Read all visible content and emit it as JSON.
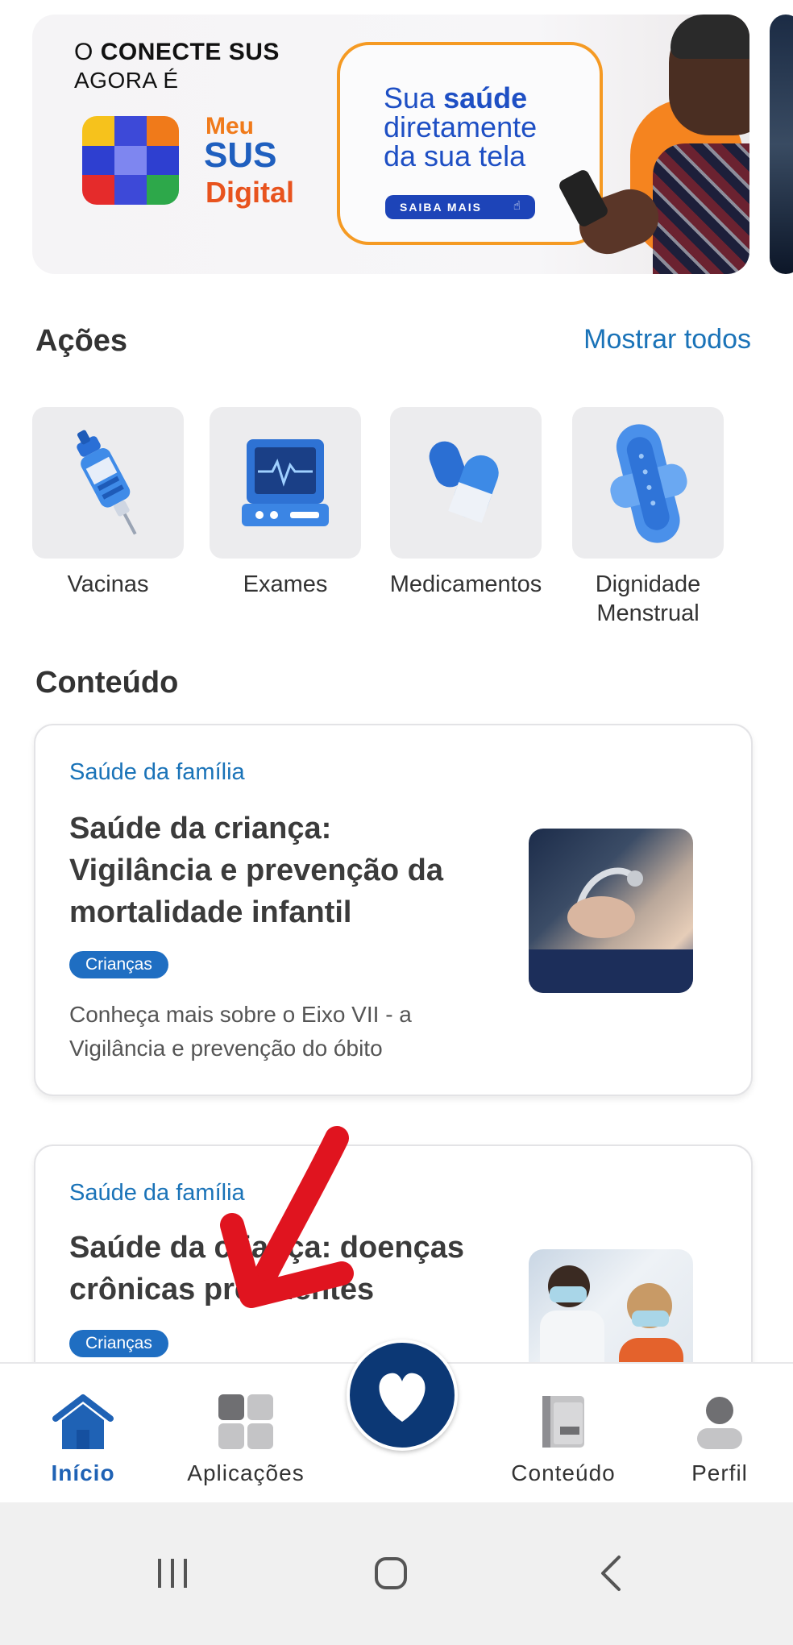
{
  "banner": {
    "line1_pre": "O",
    "line1_bold": "CONECTE SUS",
    "line2": "AGORA É",
    "brand_meu": "Meu",
    "brand_sus": "SUS",
    "brand_digital": "Digital",
    "tagline_1_pre": "Sua",
    "tagline_1_bold": "saúde",
    "tagline_2": "diretamente",
    "tagline_3": "da sua tela",
    "cta": "SAIBA MAIS"
  },
  "actions": {
    "title": "Ações",
    "show_all": "Mostrar todos",
    "items": [
      {
        "label": "Vacinas",
        "icon": "syringe-icon"
      },
      {
        "label": "Exames",
        "icon": "monitor-icon"
      },
      {
        "label": "Medicamentos",
        "icon": "pill-icon"
      },
      {
        "label_1": "Dignidade",
        "label_2": "Menstrual",
        "icon": "pad-icon"
      }
    ]
  },
  "content": {
    "title": "Conteúdo",
    "cards": [
      {
        "category": "Saúde da família",
        "title_1": "Saúde da criança:",
        "title_2": "Vigilância e prevenção da",
        "title_3": "mortalidade infantil",
        "tag": "Crianças",
        "desc_1": "Conheça mais sobre o Eixo VII - a",
        "desc_2": "Vigilância e prevenção do óbito"
      },
      {
        "category": "Saúde da família",
        "title_1": "Saúde da criança: doenças",
        "title_2": "crônicas prevalentes",
        "tag": "Crianças"
      }
    ]
  },
  "bottom_nav": {
    "items": [
      {
        "label": "Início",
        "icon": "home-icon",
        "active": true
      },
      {
        "label": "Aplicações",
        "icon": "apps-grid-icon"
      },
      {
        "label": "Conteúdo",
        "icon": "book-icon"
      },
      {
        "label": "Perfil",
        "icon": "user-icon"
      }
    ],
    "fab_icon": "heart-icon"
  },
  "colors": {
    "primary": "#1a73b8",
    "nav_active": "#1f62b5",
    "fab": "#0c3875",
    "accent_orange": "#f59a23",
    "annotation_red": "#e0141f"
  }
}
